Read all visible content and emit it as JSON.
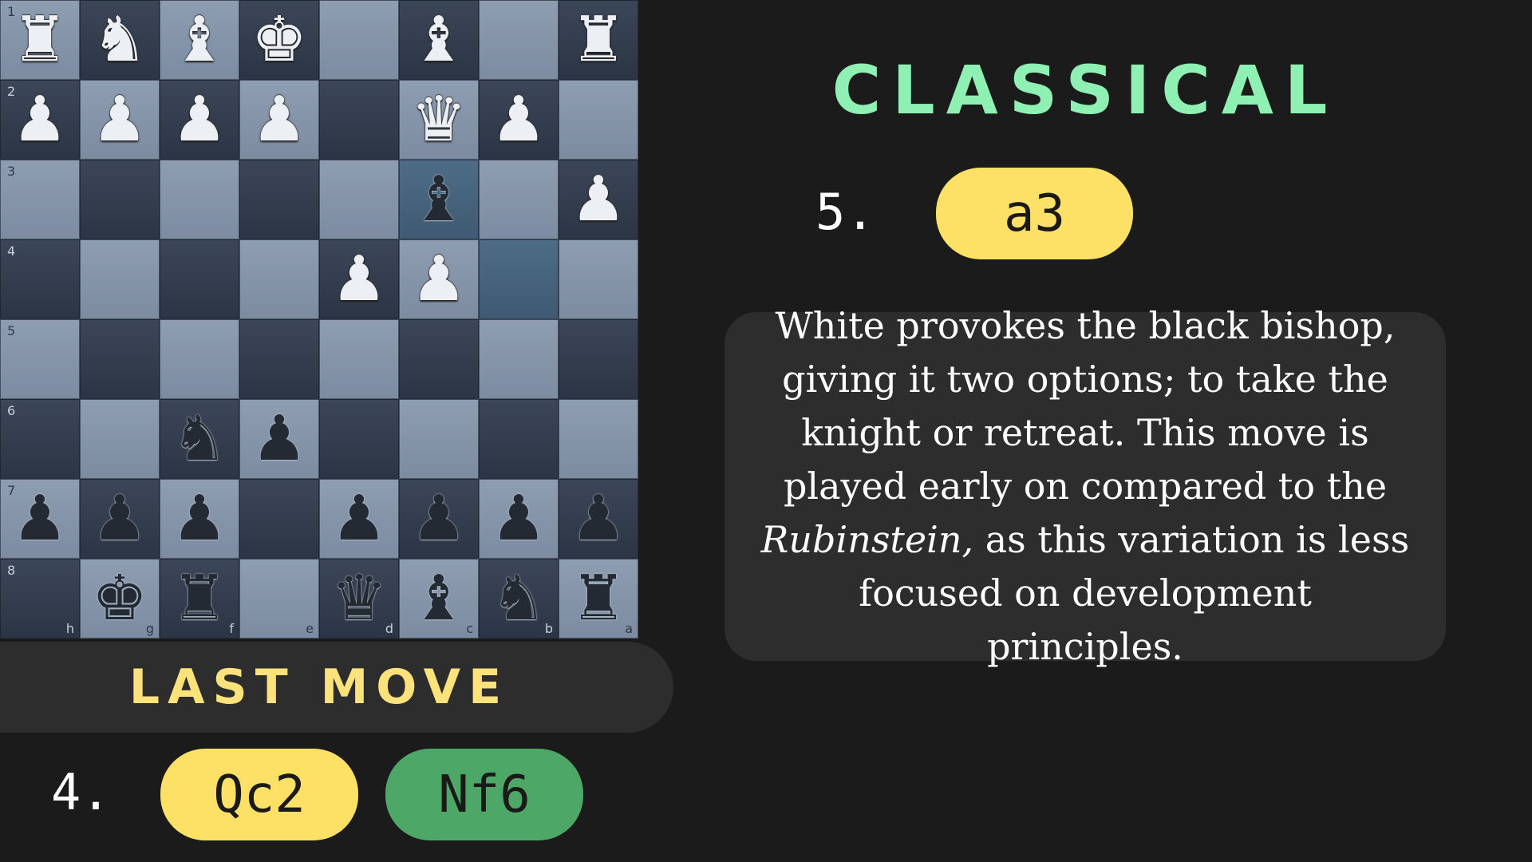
{
  "board": {
    "rank_labels": [
      "1",
      "2",
      "3",
      "4",
      "5",
      "6",
      "7",
      "8"
    ],
    "file_labels": [
      "h",
      "g",
      "f",
      "e",
      "d",
      "c",
      "b",
      "a"
    ],
    "highlighted_squares": [
      [
        2,
        5
      ],
      [
        3,
        6
      ]
    ],
    "squares": [
      [
        "wR",
        "wN",
        "wB",
        "wK",
        "",
        "wB",
        "",
        "wR"
      ],
      [
        "wP",
        "wP",
        "wP",
        "wP",
        "",
        "wQ",
        "wP",
        ""
      ],
      [
        "",
        "",
        "",
        "",
        "",
        "bB",
        "",
        "wP"
      ],
      [
        "",
        "",
        "",
        "",
        "wP",
        "wP",
        "",
        ""
      ],
      [
        "",
        "",
        "",
        "",
        "",
        "",
        "",
        ""
      ],
      [
        "",
        "",
        "bN",
        "bP",
        "",
        "",
        "",
        ""
      ],
      [
        "bP",
        "bP",
        "bP",
        "",
        "bP",
        "bP",
        "bP",
        "bP"
      ],
      [
        "",
        "bK",
        "bR",
        "",
        "bQ",
        "bB",
        "bN",
        "bR"
      ]
    ],
    "piece_glyphs": {
      "K": "♚",
      "Q": "♛",
      "R": "♜",
      "B": "♝",
      "N": "♞",
      "P": "♟"
    },
    "piece_icons": {
      "K": "king-icon",
      "Q": "queen-icon",
      "R": "rook-icon",
      "B": "bishop-icon",
      "N": "knight-icon",
      "P": "pawn-icon"
    }
  },
  "last_move": {
    "label": "LAST MOVE",
    "number": "4.",
    "white": "Qc2",
    "black": "Nf6"
  },
  "current": {
    "title": "CLASSICAL",
    "number": "5.",
    "move": "a3",
    "desc_before": "White provokes the black bishop, giving it two options; to take the knight or retreat. This move is played early on compared to the ",
    "desc_em": "Rubinstein,",
    "desc_after": " as this variation is less focused on development principles."
  },
  "colors": {
    "title": "#8ff0b3",
    "last_move_label": "#fce27a",
    "pill_yellow": "#fde166",
    "pill_green": "#4da766",
    "background": "#1b1b1b",
    "panel": "#2d2d2d"
  }
}
